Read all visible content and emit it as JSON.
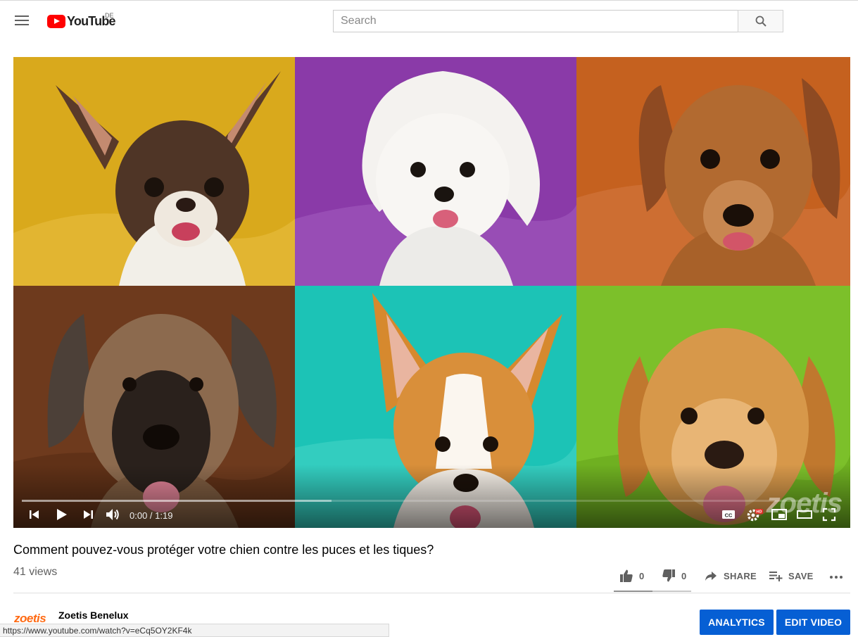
{
  "masthead": {
    "logo_text": "YouTube",
    "region": "DE",
    "search_placeholder": "Search"
  },
  "player": {
    "time_display": "0:00 / 1:19",
    "watermark": "zoetis",
    "played_fraction": 0,
    "loaded_fraction": 0.378,
    "tiles": [
      {
        "name": "chihuahua",
        "bg": "#d9a91c"
      },
      {
        "name": "maltese",
        "bg": "#8a3aa8"
      },
      {
        "name": "dachshund",
        "bg": "#c5611f"
      },
      {
        "name": "great-dane",
        "bg": "#6e3a1d"
      },
      {
        "name": "corgi",
        "bg": "#1cc3b6"
      },
      {
        "name": "golden-retriever",
        "bg": "#7cc02a"
      }
    ]
  },
  "video": {
    "title": "Comment pouvez-vous protéger votre chien contre les puces et les tiques?",
    "views": "41 views"
  },
  "actions": {
    "likes": "0",
    "dislikes": "0",
    "share_label": "SHARE",
    "save_label": "SAVE",
    "like_fraction": 0.5
  },
  "owner": {
    "logo_text": "zoetis",
    "channel_name": "Zoetis Benelux",
    "analytics_label": "ANALYTICS",
    "edit_label": "EDIT VIDEO"
  },
  "status_bar": {
    "url": "https://www.youtube.com/watch?v=eCq5OY2KF4k"
  },
  "colors": {
    "brand_red": "#ff0000",
    "accent_blue": "#065fd4",
    "zoetis_orange": "#ff6a13"
  }
}
